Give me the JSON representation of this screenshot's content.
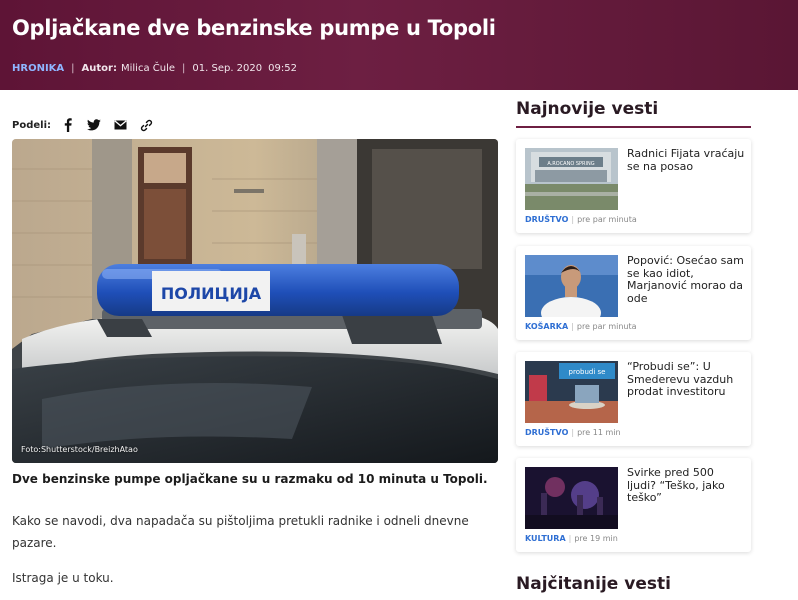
{
  "article": {
    "title": "Opljačkane dve benzinske pumpe u Topoli",
    "category": "HRONIKA",
    "author_label": "Autor:",
    "author": "Milica Čule",
    "date": "01. Sep. 2020",
    "time": "09:52",
    "share_label": "Podeli:",
    "share_icons": [
      "facebook-icon",
      "twitter-icon",
      "email-icon",
      "link-icon"
    ],
    "image_credit": "Foto:Shutterstock/BreizhAtao",
    "image_sign_text": "ПОЛИЦИЈА",
    "lead": "Dve benzinske pumpe opljačkane su u razmaku od 10 minuta u Topoli.",
    "paragraphs": [
      "Kako se navodi, dva napadača su pištoljima pretukli radnike i odneli dnevne pazare.",
      "Istraga je u toku."
    ]
  },
  "sidebar": {
    "latest_title": "Najnovije vesti",
    "most_read_title": "Najčitanije vesti",
    "items": [
      {
        "title": "Radnici Fijata vraćaju se na posao",
        "category": "DRUŠTVO",
        "time": "pre par minuta",
        "thumb_text": "A.ROCANO  SPRING"
      },
      {
        "title": "Popović: Osećao sam se kao idiot, Marjanović morao da ode",
        "category": "KOŠARKA",
        "time": "pre par minuta",
        "thumb_text": ""
      },
      {
        "title": "“Probudi se”: U Smederevu vazduh prodat investitoru",
        "category": "DRUŠTVO",
        "time": "pre 11 min",
        "thumb_text": "probudi se"
      },
      {
        "title": "Svirke pred 500 ljudi? “Teško, jako teško”",
        "category": "KULTURA",
        "time": "pre 19 min",
        "thumb_text": ""
      }
    ]
  },
  "colors": {
    "header_bg": "#6d1f42",
    "category_link": "#8fb6ff",
    "sidebar_category": "#2f6fd3",
    "title_underline": "#6e1f42"
  }
}
